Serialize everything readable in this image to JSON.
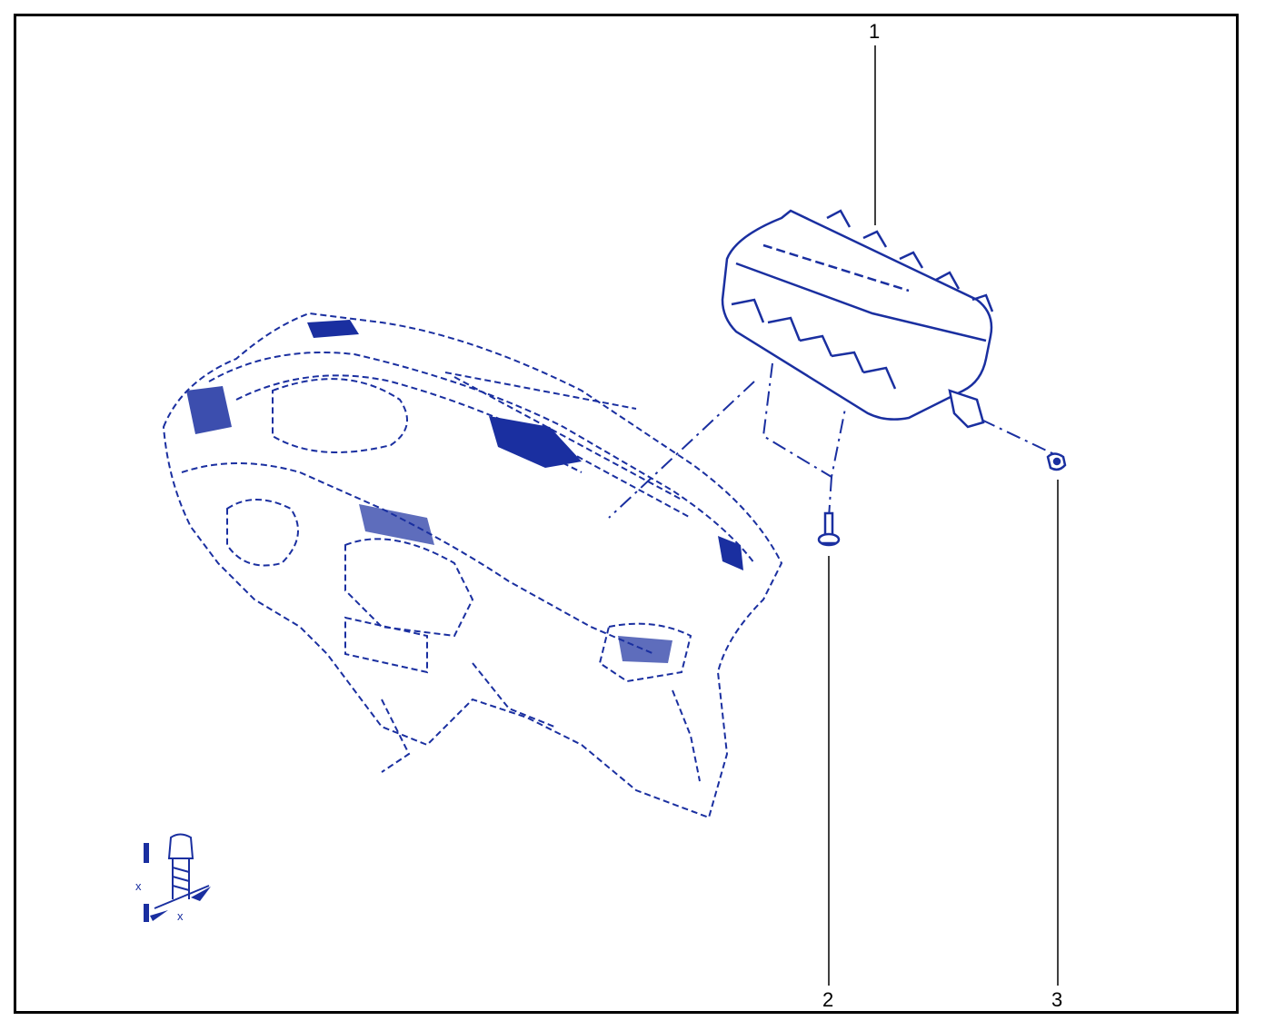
{
  "colors": {
    "line": "#1a2fa0",
    "fill": "#1a2fa0",
    "frame": "#000000"
  },
  "callouts": [
    {
      "label": "1",
      "part": "airbag-module"
    },
    {
      "label": "2",
      "part": "bolt"
    },
    {
      "label": "3",
      "part": "clip-nut"
    }
  ],
  "torque_symbol": {
    "labels": [
      "x",
      "x"
    ]
  }
}
